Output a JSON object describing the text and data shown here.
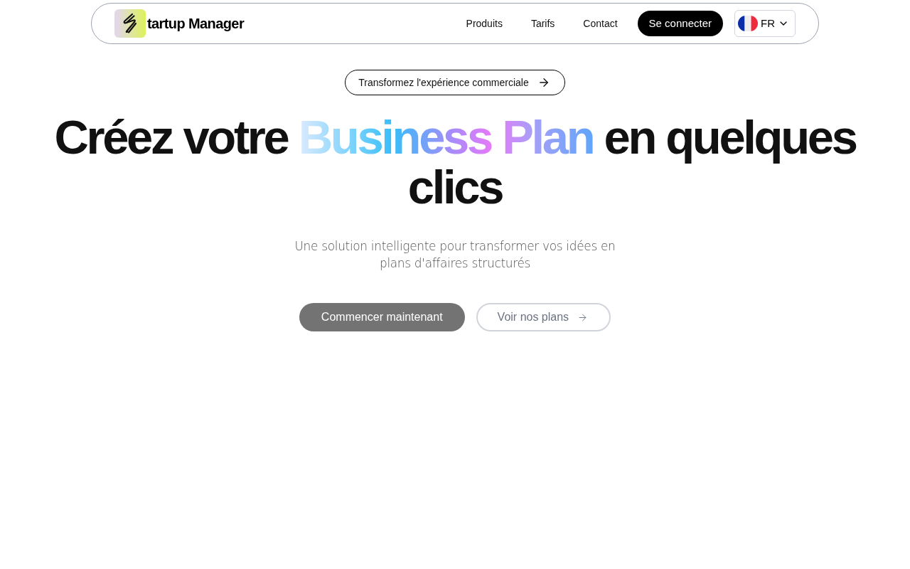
{
  "navbar": {
    "logo_text": "tartup Manager",
    "links": [
      {
        "label": "Produits"
      },
      {
        "label": "Tarifs"
      },
      {
        "label": "Contact"
      }
    ],
    "login_button": "Se connecter",
    "language": {
      "code": "FR"
    }
  },
  "hero": {
    "badge": "Transformez l'expérience commerciale",
    "heading": {
      "before": "Créez votre ",
      "highlight": "Business Plan",
      "after": " en quelques clics"
    },
    "subtitle": "Une solution intelligente pour transformer vos idées en plans d'affaires structurés",
    "buttons": [
      {
        "label": "Commencer maintenant",
        "kind": "primary"
      },
      {
        "label": "Voir nos plans",
        "kind": "secondary"
      }
    ]
  }
}
